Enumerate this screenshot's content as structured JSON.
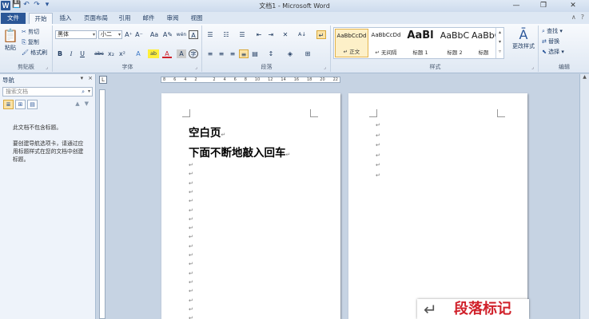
{
  "window": {
    "title": "文档1 - Microsoft Word",
    "app_icon": "W",
    "buttons": [
      "—",
      "❐",
      "✕"
    ]
  },
  "quick_access": {
    "icons": [
      "save-icon",
      "undo-icon",
      "redo-icon",
      "customize-icon"
    ],
    "glyphs": [
      "💾",
      "↶",
      "↷",
      "▾"
    ]
  },
  "tabs": [
    "文件",
    "开始",
    "插入",
    "页面布局",
    "引用",
    "邮件",
    "审阅",
    "视图"
  ],
  "ribbon_right": {
    "collapse_glyph": "∧",
    "help_glyph": "?"
  },
  "clipboard": {
    "label": "剪贴板",
    "paste": "粘贴",
    "cut": "剪切",
    "copy": "复制",
    "format_painter": "格式刷"
  },
  "font": {
    "label": "字体",
    "name": "黑体",
    "size": "小二",
    "grow": "A⁺",
    "shrink": "A⁻",
    "case": "Aa",
    "clear": "A✎",
    "phonetic": "wén",
    "border": "A",
    "bold": "B",
    "italic": "I",
    "underline": "U",
    "strike": "abc",
    "sub": "x₂",
    "sup": "x²",
    "effects": "A",
    "highlight": "ab",
    "color": "A",
    "shade": "A",
    "circle": "字"
  },
  "paragraph": {
    "label": "段落",
    "bullets": "☰",
    "numbering": "☷",
    "multilevel": "☰",
    "decrease_indent": "⇤",
    "increase_indent": "⇥",
    "chinese_layout": "✕",
    "sort": "A↓",
    "show_marks": "↵",
    "align_left": "≡",
    "center": "≡",
    "align_right": "≡",
    "justify": "≡",
    "distributed": "▤",
    "line_spacing": "↕",
    "shading": "◈",
    "borders": "⊞"
  },
  "styles": {
    "label": "样式",
    "items": [
      {
        "sample": "AaBbCcDd",
        "name": "↵ 正文"
      },
      {
        "sample": "AaBbCcDd",
        "name": "↵ 无间隔"
      },
      {
        "sample": "AaBl",
        "name": "标题 1"
      },
      {
        "sample": "AaBbC",
        "name": "标题 2"
      },
      {
        "sample": "AaBbC",
        "name": "标题"
      }
    ],
    "change_styles": "更改样式"
  },
  "editing": {
    "label": "编辑",
    "find": "查找",
    "replace": "替换",
    "select": "选择"
  },
  "nav_pane": {
    "title": "导航",
    "close": "×",
    "menu": "▾",
    "search_placeholder": "搜索文档",
    "message_1": "此文档不包含标题。",
    "message_2": "要创建导航选项卡，请通过应用标题样式在您的文档中创建标题。"
  },
  "ruler": {
    "ticks": [
      "8",
      "6",
      "4",
      "2",
      "",
      "2",
      "4",
      "6",
      "8",
      "10",
      "12",
      "14",
      "16",
      "18",
      "20",
      "22"
    ]
  },
  "document": {
    "page1_title": "空白页",
    "page1_heading2": "下面不断地敲入回车",
    "para_mark": "↵",
    "page1_marks": 19,
    "page2_marks": 6
  },
  "overlay": {
    "glyph": "↵",
    "text": "段落标记"
  }
}
